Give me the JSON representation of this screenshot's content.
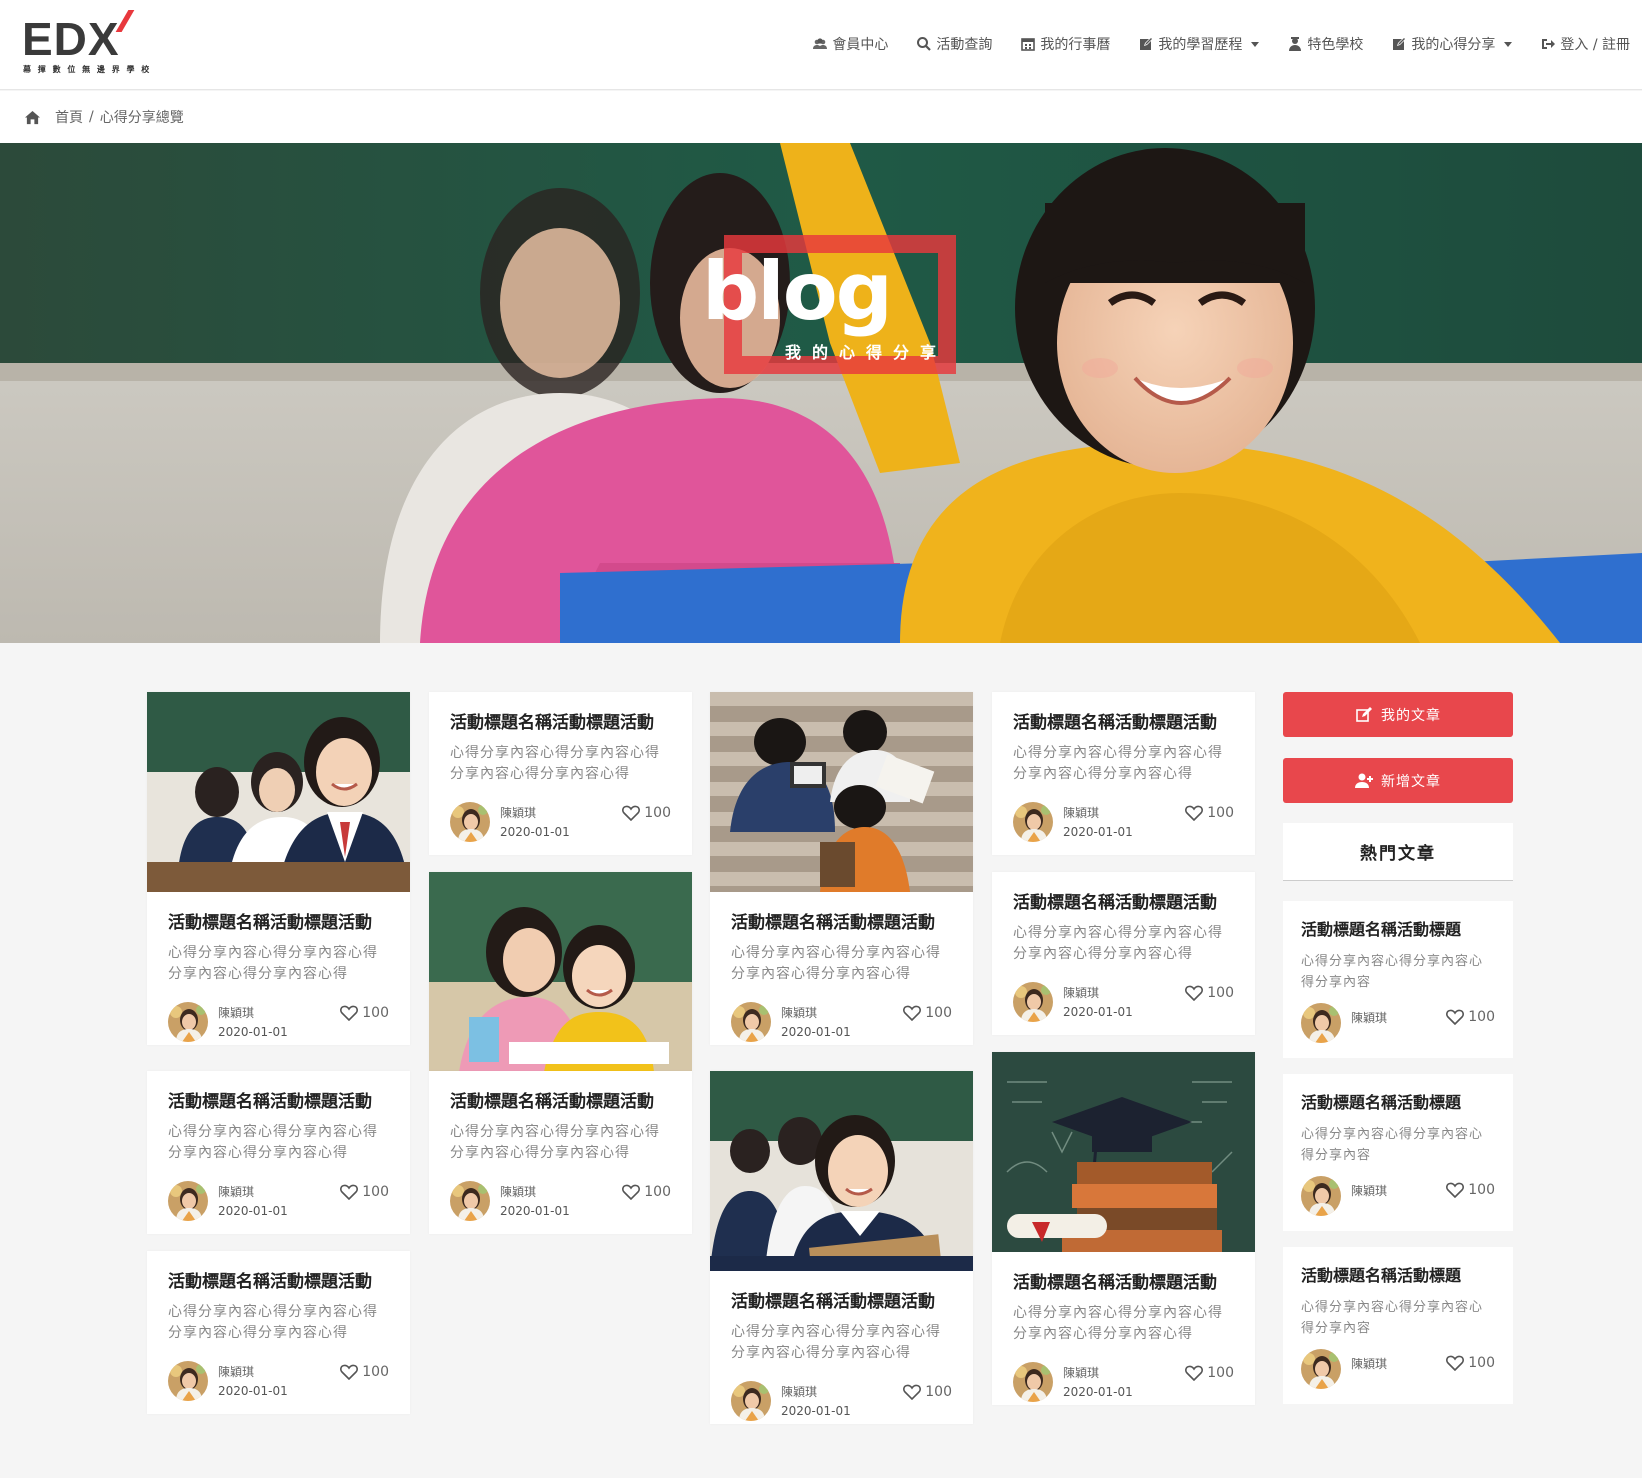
{
  "brand": {
    "logo_text": "EDX",
    "logo_sub": "幕 揮 數 位 無 邊 界 學 校"
  },
  "nav": [
    {
      "label": "會員中心",
      "icon": "users-icon",
      "caret": false
    },
    {
      "label": "活動查詢",
      "icon": "search-icon",
      "caret": false
    },
    {
      "label": "我的行事曆",
      "icon": "calendar-icon",
      "caret": false
    },
    {
      "label": "我的學習歷程",
      "icon": "edit-icon",
      "caret": true
    },
    {
      "label": "特色學校",
      "icon": "school-icon",
      "caret": false
    },
    {
      "label": "我的心得分享",
      "icon": "edit-icon",
      "caret": true
    },
    {
      "label": "登入 / 註冊",
      "icon": "sign-in-icon",
      "caret": false
    }
  ],
  "breadcrumb": {
    "home": "首頁",
    "separator": "/",
    "current": "心得分享總覽"
  },
  "hero": {
    "title": "blog",
    "subtitle": "我的心得分享"
  },
  "post": {
    "title": "活動標題名稱活動標題活動",
    "excerpt": "心得分享內容心得分享內容心得分享內容心得分享內容心得",
    "author": "陳穎琪",
    "date": "2020-01-01",
    "likes": "100"
  },
  "sidebar": {
    "my_posts": "我的文章",
    "new_post": "新增文章",
    "popular_heading": "熱門文章",
    "popular": {
      "title": "活動標題名稱活動標題",
      "excerpt": "心得分享內容心得分享內容心得分享內容",
      "author": "陳穎琪",
      "likes": "100"
    }
  },
  "colors": {
    "accent": "#e8474c",
    "hero_frame": "#e8383d",
    "background": "#f5f5f5"
  }
}
